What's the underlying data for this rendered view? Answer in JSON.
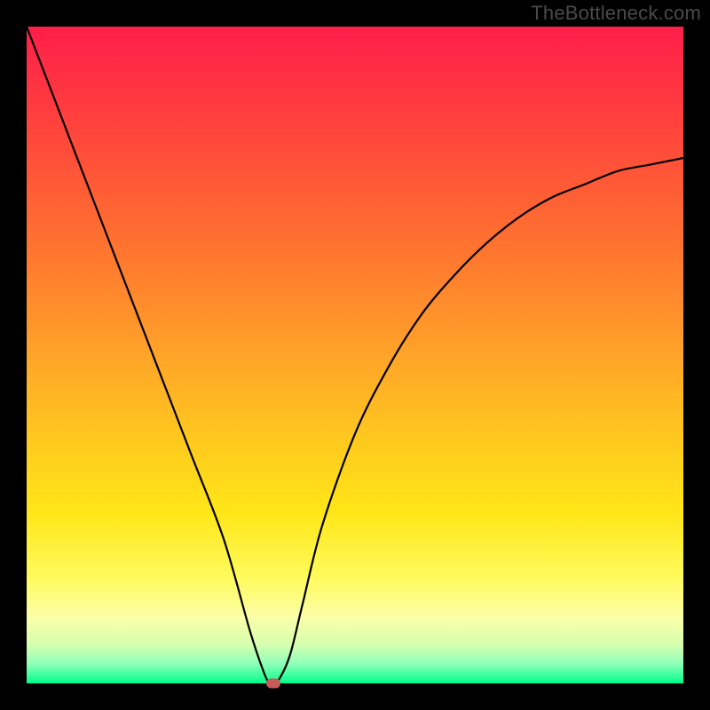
{
  "watermark": "TheBottleneck.com",
  "chart_data": {
    "type": "line",
    "title": "",
    "xlabel": "",
    "ylabel": "",
    "xlim": [
      0,
      100
    ],
    "ylim": [
      0,
      100
    ],
    "grid": false,
    "legend": false,
    "series": [
      {
        "name": "curve",
        "x": [
          0,
          5,
          10,
          15,
          20,
          25,
          30,
          34,
          36,
          37,
          38,
          40,
          42,
          45,
          50,
          55,
          60,
          65,
          70,
          75,
          80,
          85,
          90,
          95,
          100
        ],
        "y": [
          100,
          87,
          74,
          61,
          48,
          35,
          22,
          8,
          2,
          0,
          0,
          4,
          12,
          24,
          38,
          48,
          56,
          62,
          67,
          71,
          74,
          76,
          78,
          79,
          80
        ]
      }
    ],
    "marker": {
      "x": 37.5,
      "y": 0,
      "color": "#c85a5a"
    },
    "background_gradient": {
      "direction": "top-to-bottom",
      "stops": [
        {
          "pos": 0.0,
          "meaning": "worst",
          "color": "#ff1e4a"
        },
        {
          "pos": 0.5,
          "meaning": "mid",
          "color": "#ffa428"
        },
        {
          "pos": 0.8,
          "meaning": "good",
          "color": "#ffe617"
        },
        {
          "pos": 1.0,
          "meaning": "best",
          "color": "#00ff8a"
        }
      ]
    }
  }
}
